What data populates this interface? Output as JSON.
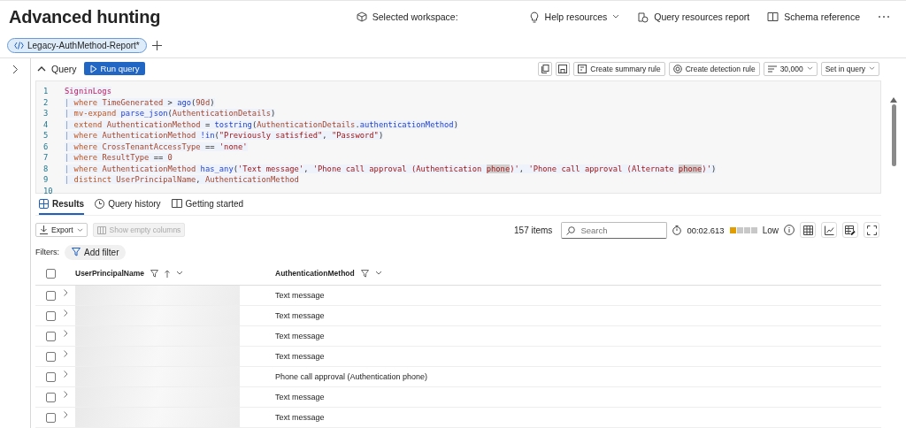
{
  "header": {
    "title": "Advanced hunting",
    "actions": [
      {
        "kind": "workspace",
        "label": "Selected workspace:",
        "dropdown": false
      },
      {
        "kind": "help",
        "label": "Help resources",
        "dropdown": true
      },
      {
        "kind": "report",
        "label": "Query resources report",
        "dropdown": false
      },
      {
        "kind": "schema",
        "label": "Schema reference",
        "dropdown": false
      }
    ]
  },
  "query_tabs": [
    {
      "label": "Legacy-AuthMethod-Report*",
      "selected": true
    }
  ],
  "query_bar": {
    "label": "Query",
    "run_button": "Run query",
    "summary_rule": "Create summary rule",
    "detection_rule": "Create detection rule",
    "limit": "30,000",
    "set_in_query": "Set in query"
  },
  "editor": {
    "lines": [
      {
        "number": "1",
        "tokens": [
          {
            "kind": "table",
            "text": "SigninLogs"
          }
        ]
      },
      {
        "number": "2",
        "tokens": [
          {
            "kind": "pipe",
            "text": "| "
          },
          {
            "kind": "keyword",
            "text": "where "
          },
          {
            "kind": "ident",
            "text": "TimeGenerated"
          },
          {
            "kind": "op",
            "text": " > "
          },
          {
            "kind": "func",
            "text": "ago"
          },
          {
            "kind": "op",
            "text": "("
          },
          {
            "kind": "ident",
            "text": "90d"
          },
          {
            "kind": "op",
            "text": ")"
          }
        ]
      },
      {
        "number": "3",
        "tokens": [
          {
            "kind": "pipe",
            "text": "| "
          },
          {
            "kind": "keyword",
            "text": "mv-expand "
          },
          {
            "kind": "func",
            "text": "parse_json"
          },
          {
            "kind": "op",
            "text": "("
          },
          {
            "kind": "ident",
            "text": "AuthenticationDetails"
          },
          {
            "kind": "op",
            "text": ")"
          }
        ]
      },
      {
        "number": "4",
        "tokens": [
          {
            "kind": "pipe",
            "text": "| "
          },
          {
            "kind": "keyword",
            "text": "extend "
          },
          {
            "kind": "ident",
            "text": "AuthenticationMethod"
          },
          {
            "kind": "op",
            "text": " = "
          },
          {
            "kind": "func",
            "text": "tostring"
          },
          {
            "kind": "op",
            "text": "("
          },
          {
            "kind": "ident",
            "text": "AuthenticationDetails"
          },
          {
            "kind": "op",
            "text": "."
          },
          {
            "kind": "func",
            "text": "authenticationMethod"
          },
          {
            "kind": "op",
            "text": ")"
          }
        ]
      },
      {
        "number": "5",
        "tokens": [
          {
            "kind": "pipe",
            "text": "| "
          },
          {
            "kind": "keyword",
            "text": "where "
          },
          {
            "kind": "ident",
            "text": "AuthenticationMethod "
          },
          {
            "kind": "func",
            "text": "!in"
          },
          {
            "kind": "op",
            "text": "("
          },
          {
            "kind": "string",
            "text": "\"Previously satisfied\""
          },
          {
            "kind": "op",
            "text": ", "
          },
          {
            "kind": "string",
            "text": "\"Password\""
          },
          {
            "kind": "op",
            "text": ")"
          }
        ]
      },
      {
        "number": "6",
        "tokens": [
          {
            "kind": "pipe",
            "text": "| "
          },
          {
            "kind": "keyword",
            "text": "where "
          },
          {
            "kind": "ident",
            "text": "CrossTenantAccessType"
          },
          {
            "kind": "op",
            "text": " == "
          },
          {
            "kind": "string",
            "text": "'none'"
          }
        ]
      },
      {
        "number": "7",
        "tokens": [
          {
            "kind": "pipe",
            "text": "| "
          },
          {
            "kind": "keyword",
            "text": "where "
          },
          {
            "kind": "ident",
            "text": "ResultType"
          },
          {
            "kind": "op",
            "text": " == "
          },
          {
            "kind": "ident",
            "text": "0"
          }
        ]
      },
      {
        "number": "8",
        "tokens": [
          {
            "kind": "pipe",
            "text": "| "
          },
          {
            "kind": "keyword",
            "text": "where "
          },
          {
            "kind": "ident",
            "text": "AuthenticationMethod "
          },
          {
            "kind": "func",
            "text": "has_any"
          },
          {
            "kind": "op",
            "text": "("
          },
          {
            "kind": "string",
            "text": "'Text message'"
          },
          {
            "kind": "op",
            "text": ", "
          },
          {
            "kind": "string",
            "text": "'Phone call approval (Authentication "
          },
          {
            "kind": "match",
            "text": "phone"
          },
          {
            "kind": "string",
            "text": ")'"
          },
          {
            "kind": "op",
            "text": ", "
          },
          {
            "kind": "string",
            "text": "'Phone call approval (Alternate "
          },
          {
            "kind": "match",
            "text": "phone"
          },
          {
            "kind": "string",
            "text": ")'"
          },
          {
            "kind": "op",
            "text": ")"
          }
        ]
      },
      {
        "number": "9",
        "tokens": [
          {
            "kind": "pipe",
            "text": "| "
          },
          {
            "kind": "keyword",
            "text": "distinct "
          },
          {
            "kind": "ident",
            "text": "UserPrincipalName"
          },
          {
            "kind": "op",
            "text": ", "
          },
          {
            "kind": "ident",
            "text": "AuthenticationMethod"
          }
        ]
      },
      {
        "number": "10"
      }
    ]
  },
  "result_tabs": [
    {
      "label": "Results",
      "kind": "grid",
      "selected": true
    },
    {
      "label": "Query history",
      "kind": "clock",
      "selected": false
    },
    {
      "label": "Getting started",
      "kind": "book",
      "selected": false
    }
  ],
  "toolbar": {
    "export": "Export",
    "show_empty": {
      "label": "Show empty columns",
      "disabled": true
    },
    "count": "157 items",
    "search": {
      "placeholder": "Search"
    },
    "duration": "00:02.613",
    "usage": {
      "level": 0.25,
      "label": "Low"
    }
  },
  "filters": {
    "label": "Filters:",
    "add_button": "Add filter"
  },
  "table": {
    "select_all": {
      "checked": false
    },
    "columns": [
      {
        "label": "UserPrincipalName",
        "sorted": true
      },
      {
        "label": "AuthenticationMethod",
        "sorted": false
      }
    ],
    "rows": [
      {
        "checked": false,
        "redacted": true,
        "method": "Text message"
      },
      {
        "checked": false,
        "redacted": true,
        "method": "Text message"
      },
      {
        "checked": false,
        "redacted": true,
        "method": "Text message"
      },
      {
        "checked": false,
        "redacted": true,
        "method": "Text message"
      },
      {
        "checked": false,
        "redacted": true,
        "method": "Phone call approval (Authentication phone)"
      },
      {
        "checked": false,
        "redacted": true,
        "method": "Text message"
      },
      {
        "checked": false,
        "redacted": true,
        "method": "Text message"
      }
    ]
  }
}
